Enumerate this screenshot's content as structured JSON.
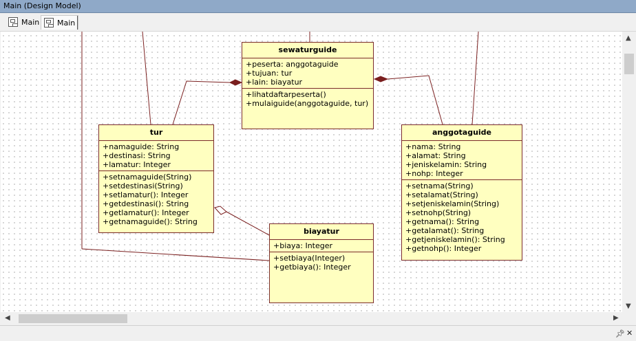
{
  "window": {
    "title": "Main (Design Model)"
  },
  "tabs": [
    {
      "label": "Main"
    },
    {
      "label": "Main"
    }
  ],
  "classes": {
    "sewaturguide": {
      "name": "sewaturguide",
      "attributes": [
        "+peserta: anggotaguide",
        "+tujuan: tur",
        "+lain: biayatur"
      ],
      "operations": [
        "+lihatdaftarpeserta()",
        "+mulaiguide(anggotaguide, tur)"
      ]
    },
    "tur": {
      "name": "tur",
      "attributes": [
        "+namaguide: String",
        "+destinasi: String",
        "+lamatur: Integer"
      ],
      "operations": [
        "+setnamaguide(String)",
        "+setdestinasi(String)",
        "+setlamatur(): Integer",
        "+getdestinasi(): String",
        "+getlamatur(): Integer",
        "+getnamaguide(): String"
      ]
    },
    "anggotaguide": {
      "name": "anggotaguide",
      "attributes": [
        "+nama: String",
        "+alamat: String",
        "+jeniskelamin: String",
        "+nohp: Integer"
      ],
      "operations": [
        "+setnama(String)",
        "+setalamat(String)",
        "+setjeniskelamin(String)",
        "+setnohp(String)",
        "+getnama(): String",
        "+getalamat(): String",
        "+getjeniskelamin(): String",
        "+getnohp(): Integer"
      ]
    },
    "biayatur": {
      "name": "biayatur",
      "attributes": [
        "+biaya: Integer"
      ],
      "operations": [
        "+setbiaya(Integer)",
        "+getbiaya(): Integer"
      ]
    }
  },
  "colors": {
    "class_fill": "#ffffc0",
    "class_border": "#7a2a2a",
    "link": "#7a1f1f"
  },
  "icons": {
    "tab": "diagram-icon",
    "scroll_up": "▲",
    "scroll_down": "▼",
    "scroll_left": "◀",
    "scroll_right": "▶",
    "pin": "pin-icon",
    "close": "close-icon",
    "move": "move-icon"
  }
}
